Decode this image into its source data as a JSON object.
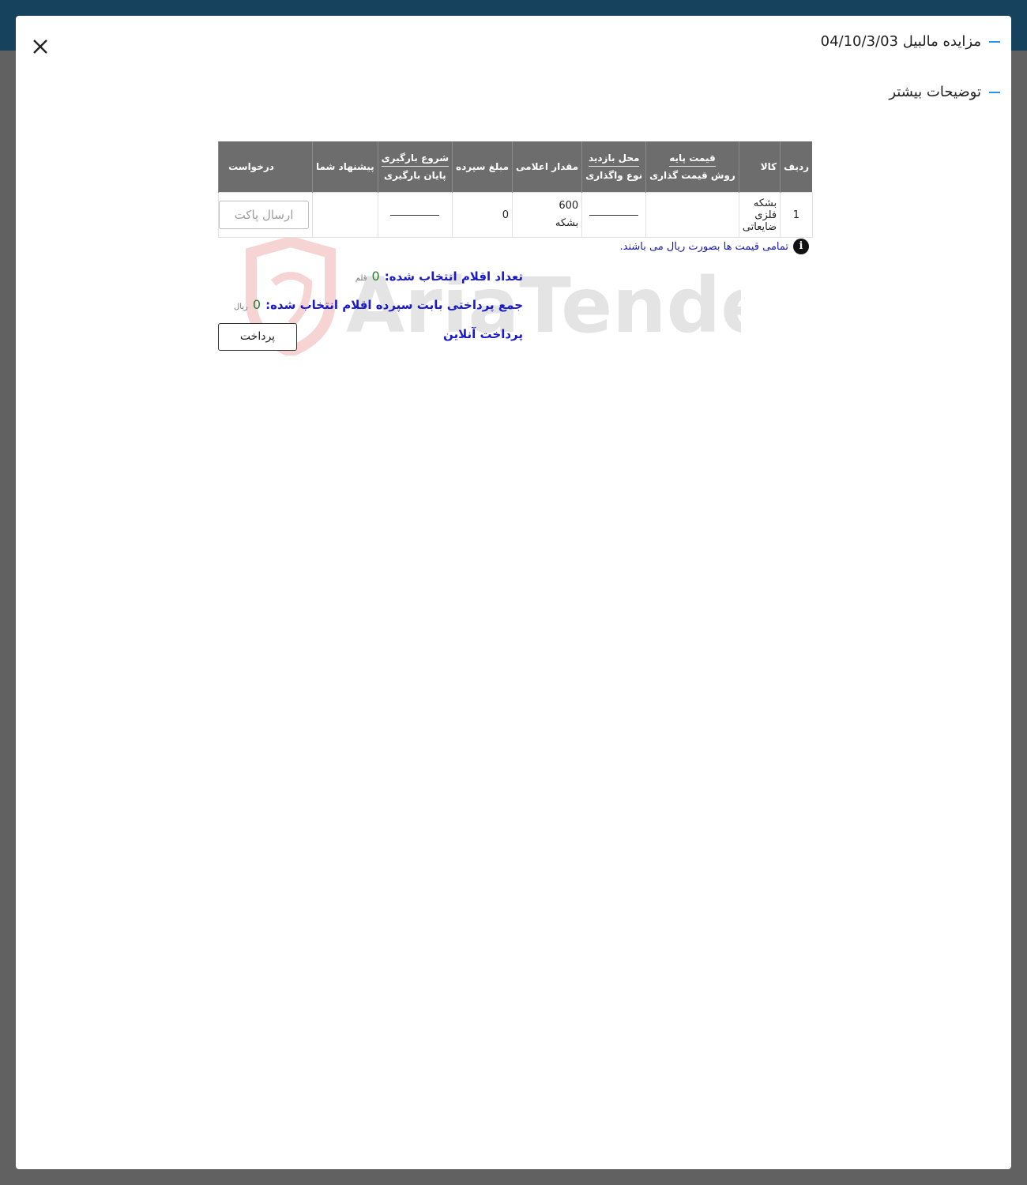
{
  "header": {
    "title": "مزایده مالبیل 04/10/3/03",
    "more_details": "توضیحات بیشتر"
  },
  "table": {
    "headers": {
      "row": "ردیف",
      "item": "کالا",
      "base_price": "قیمت پایه",
      "pricing_method": "روش قیمت گذاری",
      "visit_place": "محل بازدید",
      "assignment_type": "نوع واگذاری",
      "announced_qty": "مقدار اعلامی",
      "deposit_amount": "مبلغ سپرده",
      "loading_start": "شروع بارگیری",
      "loading_end": "پایان بارگیری",
      "your_offer": "پیشنهاد شما",
      "request": "درخواست"
    },
    "rows": [
      {
        "row": "1",
        "item": "بشکه فلزی ضایعاتی",
        "base_price": "",
        "visit_place": "",
        "qty_value": "600",
        "qty_unit": "بشکه",
        "deposit": "0",
        "loading": "",
        "offer": "",
        "request_button": "ارسال پاکت"
      }
    ]
  },
  "note": {
    "icon": "info-icon",
    "text": "تمامی قیمت ها بصورت ریال می باشند."
  },
  "summary": {
    "selected_label": "تعداد اقلام انتخاب شده:",
    "selected_count": "0",
    "selected_unit": "قلم",
    "total_label": "جمع پرداختی بابت سپرده اقلام انتخاب شده:",
    "total_value": "0",
    "total_unit": "ریال",
    "online_payment": "پرداخت آنلاین",
    "pay_button": "پرداخت"
  },
  "watermark": {
    "text": "AriaTender.neT"
  },
  "colors": {
    "header_bg": "#16425e",
    "accent": "#2196f3",
    "table_header": "#6d6d6d",
    "link_blue": "#1a1acc",
    "number_green": "#2e7d32"
  }
}
